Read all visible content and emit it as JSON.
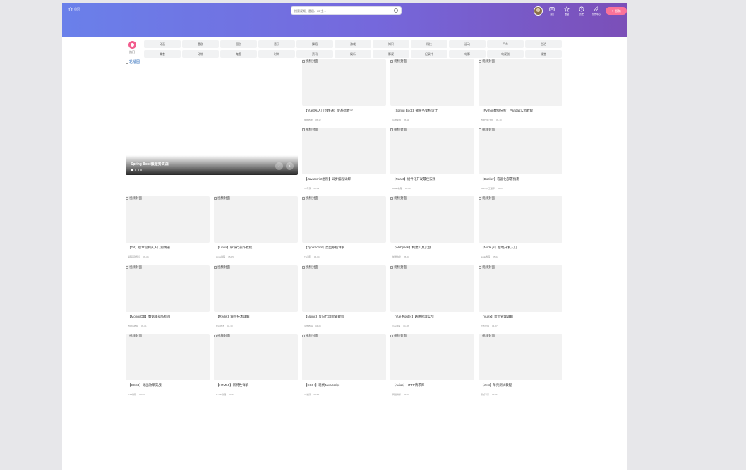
{
  "header": {
    "home_label": "首页",
    "search_placeholder": "搜索视频、番剧、UP主...",
    "nav": [
      {
        "icon": "message-icon",
        "label": "消息"
      },
      {
        "icon": "favorites-icon",
        "label": "收藏"
      },
      {
        "icon": "history-icon",
        "label": "历史"
      },
      {
        "icon": "creation-icon",
        "label": "创作中心"
      }
    ],
    "upload_label": "投稿"
  },
  "categories": {
    "hot_label": "热门",
    "items": [
      "动画",
      "番剧",
      "国创",
      "音乐",
      "舞蹈",
      "游戏",
      "知识",
      "科技",
      "运动",
      "汽车",
      "生活",
      "美食",
      "动物",
      "鬼畜",
      "时尚",
      "资讯",
      "娱乐",
      "影视",
      "纪录片",
      "电影",
      "电视剧",
      "课堂"
    ]
  },
  "carousel": {
    "image_alt": "轮播图",
    "title": "Spring Boot微服务实战",
    "prev_icon": "‹",
    "next_icon": "›"
  },
  "thumb_alt": "视频封面",
  "videos": [
    {
      "title": "【Vue3从入门到精通】零基础教学",
      "up": "前端教学",
      "date": "05-12"
    },
    {
      "title": "【Spring Boot】微服务架构设计",
      "up": "后端架构",
      "date": "05-11"
    },
    {
      "title": "【Python数据分析】Pandas实战教程",
      "up": "数据分析大师",
      "date": "05-10"
    },
    {
      "title": "【JavaScript进阶】异步编程详解",
      "up": "JS专家",
      "date": "05-09"
    },
    {
      "title": "【React】组件化开发最佳实践",
      "up": "React教程",
      "date": "05-08"
    },
    {
      "title": "【Docker】容器化部署指南",
      "up": "DevOps工程师",
      "date": "05-07"
    },
    {
      "title": "【Git】版本控制从入门到精通",
      "up": "编程基础知识",
      "date": "05-06"
    },
    {
      "title": "【Linux】命令行操作教程",
      "up": "Linux教程",
      "date": "05-05"
    },
    {
      "title": "【TypeScript】类型系统详解",
      "up": "TS进阶",
      "date": "05-04"
    },
    {
      "title": "【Webpack】构建工具实战",
      "up": "前端构建",
      "date": "05-03"
    },
    {
      "title": "【Node.js】后端开发入门",
      "up": "Node教程",
      "date": "05-02"
    },
    {
      "title": "【MongoDB】数据库操作指南",
      "up": "数据库教程",
      "date": "05-01"
    },
    {
      "title": "【Redis】缓存技术详解",
      "up": "缓存技术",
      "date": "04-30"
    },
    {
      "title": "【Nginx】反向代理配置教程",
      "up": "运维教程",
      "date": "04-29"
    },
    {
      "title": "【Vue Router】路由管理实战",
      "up": "Vue教程",
      "date": "04-28"
    },
    {
      "title": "【Vuex】状态管理详解",
      "up": "状态管理",
      "date": "04-27"
    },
    {
      "title": "【CSS3】动画效果实战",
      "up": "CSS教程",
      "date": "04-26"
    },
    {
      "title": "【HTML5】新特性详解",
      "up": "HTML教程",
      "date": "04-25"
    },
    {
      "title": "【ES6+】现代JavaScript",
      "up": "JS进阶",
      "date": "04-24"
    },
    {
      "title": "【Axios】HTTP请求库",
      "up": "网络请求",
      "date": "04-23"
    },
    {
      "title": "【Jest】单元测试教程",
      "up": "测试专家",
      "date": "04-22"
    }
  ]
}
